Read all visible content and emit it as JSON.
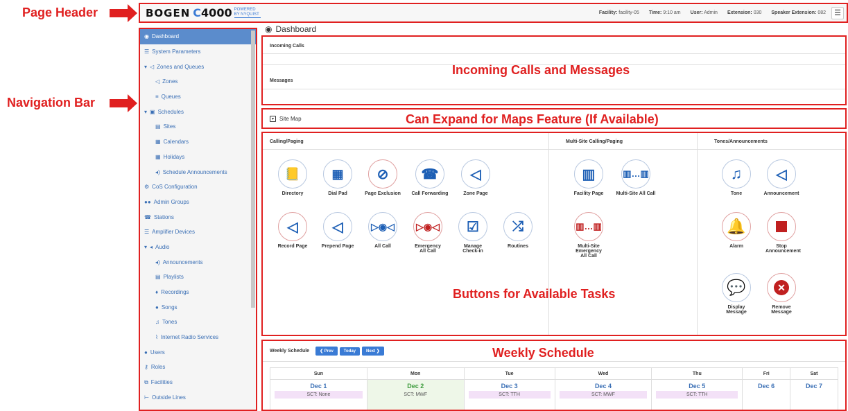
{
  "annotations": {
    "page_header": "Page Header",
    "navigation_bar": "Navigation Bar",
    "incoming": "Incoming Calls and Messages",
    "site_map_note": "Can Expand for Maps Feature (If Available)",
    "buttons_note": "Buttons for Available Tasks",
    "weekly_note": "Weekly Schedule"
  },
  "header": {
    "brand": "BOGEN",
    "product": "C4000",
    "powered": "POWERED BY NYQUIST",
    "facility_label": "Facility:",
    "facility": "facility-05",
    "time_label": "Time:",
    "time": "9:10 am",
    "user_label": "User:",
    "user": "Admin",
    "ext_label": "Extension:",
    "ext": "030",
    "spk_label": "Speaker Extension:",
    "spk": "082"
  },
  "sidebar": {
    "items": [
      {
        "label": "Dashboard",
        "icon": "dashboard-icon"
      },
      {
        "label": "System Parameters",
        "icon": "list-icon"
      },
      {
        "label": "Zones and Queues",
        "icon": "megaphone-icon"
      },
      {
        "label": "Zones",
        "icon": "megaphone-icon"
      },
      {
        "label": "Queues",
        "icon": "bars-icon"
      },
      {
        "label": "Schedules",
        "icon": "calendar-icon"
      },
      {
        "label": "Sites",
        "icon": "building-icon"
      },
      {
        "label": "Calendars",
        "icon": "calendar-icon"
      },
      {
        "label": "Holidays",
        "icon": "calendar-icon"
      },
      {
        "label": "Schedule Announcements",
        "icon": "speaker-icon"
      },
      {
        "label": "CoS Configuration",
        "icon": "cogs-icon"
      },
      {
        "label": "Admin Groups",
        "icon": "users-icon"
      },
      {
        "label": "Stations",
        "icon": "phone-icon"
      },
      {
        "label": "Amplifier Devices",
        "icon": "server-icon"
      },
      {
        "label": "Audio",
        "icon": "volume-icon"
      },
      {
        "label": "Announcements",
        "icon": "speaker-icon"
      },
      {
        "label": "Playlists",
        "icon": "playlist-icon"
      },
      {
        "label": "Recordings",
        "icon": "mic-icon"
      },
      {
        "label": "Songs",
        "icon": "disc-icon"
      },
      {
        "label": "Tones",
        "icon": "music-icon"
      },
      {
        "label": "Internet Radio Services",
        "icon": "rss-icon"
      },
      {
        "label": "Users",
        "icon": "user-icon"
      },
      {
        "label": "Roles",
        "icon": "key-icon"
      },
      {
        "label": "Facilities",
        "icon": "sitemap-icon"
      },
      {
        "label": "Outside Lines",
        "icon": "line-icon"
      }
    ]
  },
  "main": {
    "title": "Dashboard",
    "incoming_calls": "Incoming Calls",
    "messages": "Messages",
    "site_map": "Site Map",
    "calling_paging": "Calling/Paging",
    "multi_site": "Multi-Site Calling/Paging",
    "tones_ann": "Tones/Announcements"
  },
  "tasks": {
    "directory": "Directory",
    "dial_pad": "Dial Pad",
    "page_exclusion": "Page Exclusion",
    "call_forwarding": "Call Forwarding",
    "zone_page": "Zone Page",
    "record_page": "Record Page",
    "prepend_page": "Prepend Page",
    "all_call": "All Call",
    "emergency_all_call": "Emergency All Call",
    "manage_checkin": "Manage Check-in",
    "routines": "Routines",
    "facility_page": "Facility Page",
    "multi_site_all_call": "Multi-Site All Call",
    "multi_site_emergency": "Multi-Site Emergency All Call",
    "tone": "Tone",
    "announcement": "Announcement",
    "alarm": "Alarm",
    "stop_announcement": "Stop Announcement",
    "display_message": "Display Message",
    "remove_message": "Remove Message"
  },
  "schedule": {
    "title": "Weekly Schedule",
    "prev": "❮ Prev",
    "today": "Today",
    "next": "Next ❯",
    "days": [
      "Sun",
      "Mon",
      "Tue",
      "Wed",
      "Thu",
      "Fri",
      "Sat"
    ],
    "dates": [
      "Dec 1",
      "Dec 2",
      "Dec 3",
      "Dec 4",
      "Dec 5",
      "Dec 6",
      "Dec 7"
    ],
    "sct": [
      "SCT: None",
      "SCT: MWF",
      "SCT: TTH",
      "SCT: MWF",
      "SCT: TTH",
      "",
      ""
    ]
  },
  "colors": {
    "accent": "#3a7bd5",
    "annotation": "#e02020",
    "active_nav": "#5b8ccc"
  }
}
